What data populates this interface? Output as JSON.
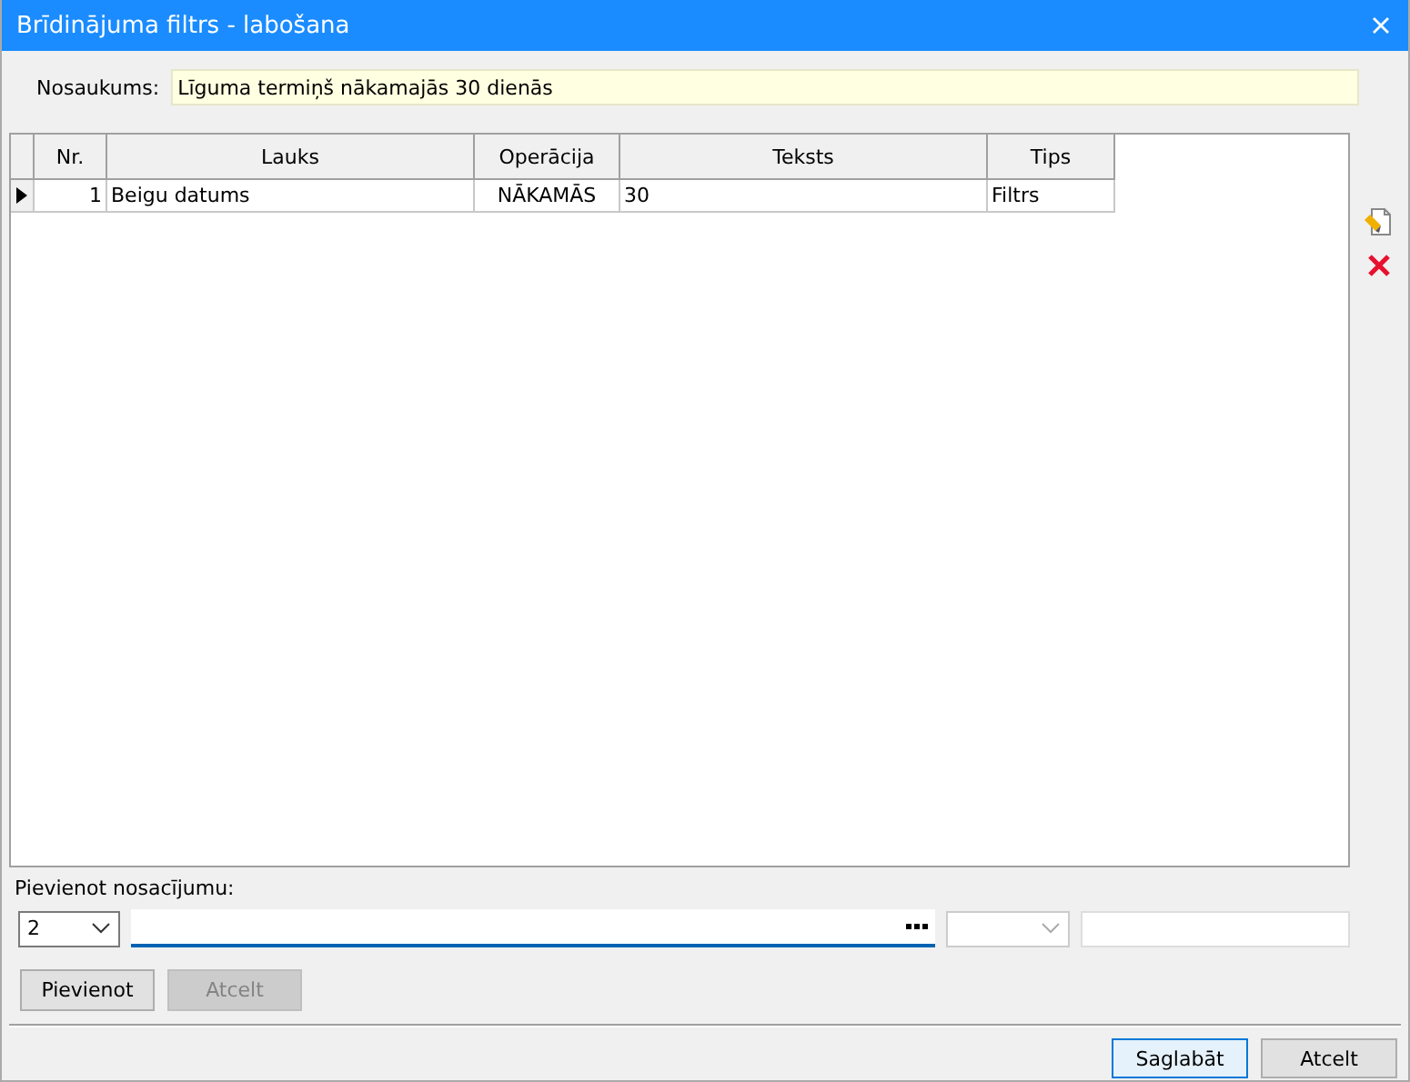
{
  "window": {
    "title": "Brīdinājuma filtrs - labošana"
  },
  "name_field": {
    "label": "Nosaukums:",
    "value": "Līguma termiņš nākamajās 30 dienās"
  },
  "table": {
    "columns": [
      "Nr.",
      "Lauks",
      "Operācija",
      "Teksts",
      "Tips"
    ],
    "rows": [
      {
        "selected": true,
        "cells": [
          "1",
          "Beigu datums",
          "NĀKAMĀS",
          "30",
          "Filtrs"
        ]
      }
    ]
  },
  "add_condition": {
    "label": "Pievienot nosacījumu:",
    "number": "2",
    "buttons": [
      {
        "label": "Pievienot",
        "disabled": false
      },
      {
        "label": "Atcelt",
        "disabled": true
      }
    ]
  },
  "footer_buttons": [
    {
      "label": "Saglabāt",
      "default": true
    },
    {
      "label": "Atcelt",
      "default": false
    }
  ]
}
